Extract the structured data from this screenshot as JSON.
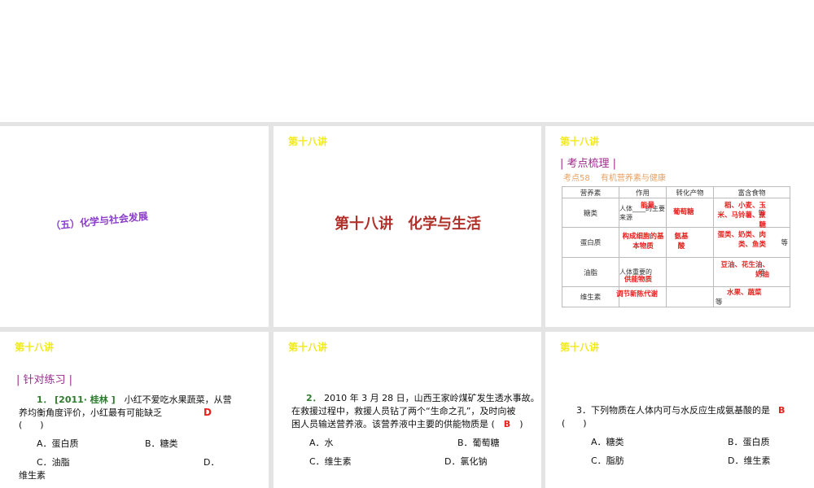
{
  "colors": {
    "header": "#f2ea1a",
    "section": "#9c2a8e",
    "answer": "#e8201e",
    "title": "#b0302a"
  },
  "slide1": {
    "title": "（五）化学与社会发展"
  },
  "slide2": {
    "header": "第十八讲",
    "title": "第十八讲　化学与生活"
  },
  "slide3": {
    "header": "第十八讲",
    "section": "| 考点梳理 |",
    "subtitle": "考点58　 有机营养素与健康",
    "columns": [
      "营养素",
      "作用",
      "转化产物",
      "富含食物"
    ],
    "rows": [
      {
        "name": "糖类",
        "role": "人体____的主要来源",
        "role_ans": "能量",
        "product_ans": "葡萄糖",
        "food_ans": "稻、小麦、玉米、马铃薯、蔗糖",
        "food_suffix": "等"
      },
      {
        "name": "蛋白质",
        "role": "",
        "role_ans": "构成细胞的基本物质",
        "product_ans": "氨基酸",
        "food_ans": "蛋类、奶类、肉类、鱼类",
        "food_suffix": "等"
      },
      {
        "name": "油脂",
        "role": "人体重要的",
        "role_ans": "供能物质",
        "product_ans": "",
        "food_ans": "豆油、花生油、奶油",
        "food_suffix": "等"
      },
      {
        "name": "维生素",
        "role": "",
        "role_ans": "调节新陈代谢",
        "product_ans": "",
        "food_ans": "水果、蔬菜",
        "food_suffix": "等"
      }
    ]
  },
  "slide4": {
    "header": "第十八讲",
    "section": "| 针对练习 |",
    "num": "1．",
    "source": "[2011· 桂林 ]",
    "q1": "小红不爱吃水果蔬菜，从营",
    "q2": "养均衡角度评价，小红最有可能缺乏",
    "q3": "(　　)",
    "answer": "D",
    "options": [
      "A．蛋白质",
      "B．糖类",
      "C．油脂",
      "D．",
      "维生素"
    ]
  },
  "slide5": {
    "header": "第十八讲",
    "num": "2．",
    "q1": "2010 年 3 月 28 日，山西王家岭煤矿发生透水事故。",
    "q2": "在救援过程中，救援人员钻了两个“生命之孔”，及时向被",
    "q3": "困人员输送营养液。该营养液中主要的供能物质是 (",
    "q3end": ")",
    "answer": "B",
    "options": [
      "A．水",
      "B．葡萄糖",
      "C．维生素",
      "D．氯化钠"
    ]
  },
  "slide6": {
    "header": "第十八讲",
    "q1": "3．下列物质在人体内可与水反应生成氨基酸的是",
    "q2": "(　　)",
    "answer": "B",
    "options": [
      "A．糖类",
      "B．蛋白质",
      "C．脂肪",
      "D．维生素"
    ]
  }
}
